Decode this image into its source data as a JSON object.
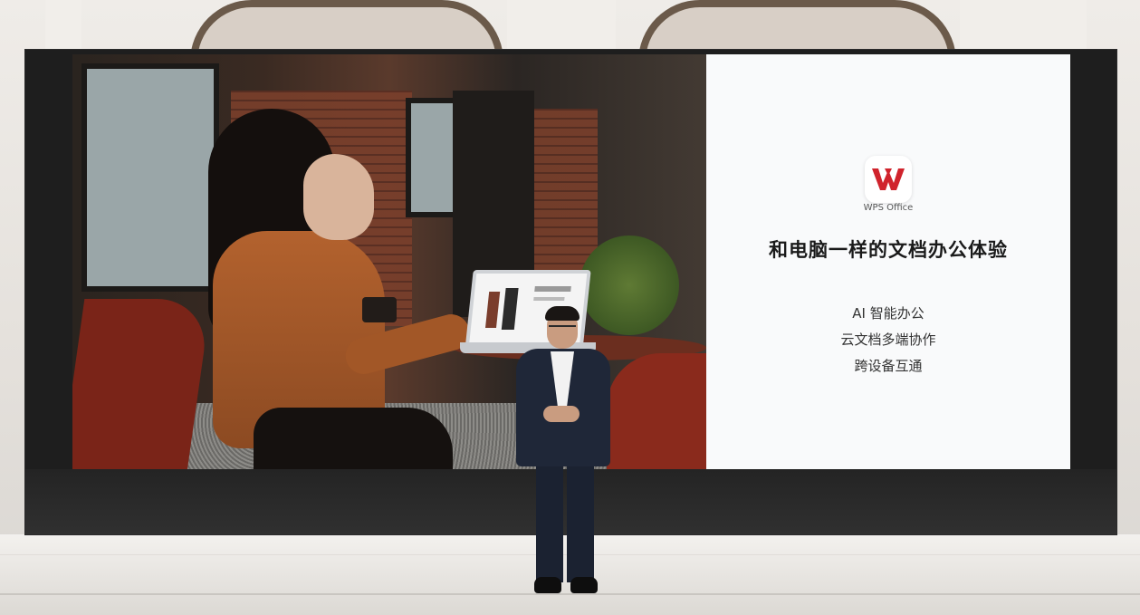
{
  "slide": {
    "logo_icon": "wps-office-logo-icon",
    "logo_label": "WPS Office",
    "title": "和电脑一样的文档办公体验",
    "features": [
      "AI 智能办公",
      "云文档多端协作",
      "跨设备互通"
    ],
    "brand_color": "#d0232c"
  }
}
